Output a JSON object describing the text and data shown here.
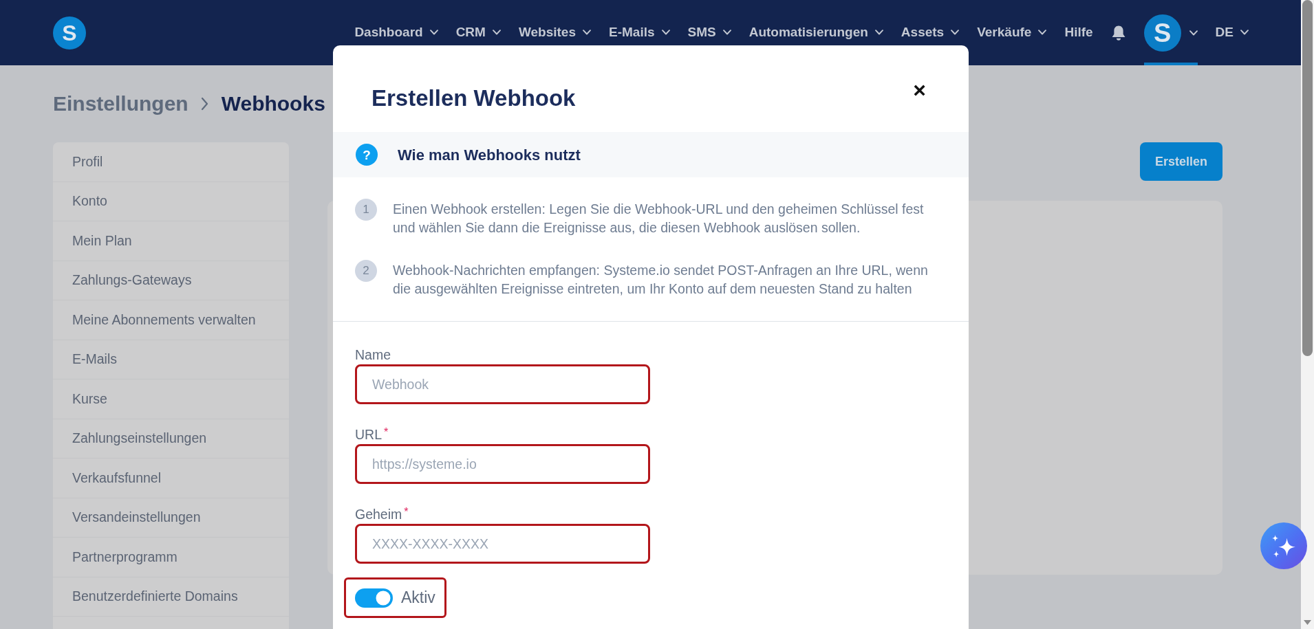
{
  "navbar": {
    "logo": "S",
    "menu": [
      {
        "label": "Dashboard",
        "dropdown": true
      },
      {
        "label": "CRM",
        "dropdown": true
      },
      {
        "label": "Websites",
        "dropdown": true
      },
      {
        "label": "E-Mails",
        "dropdown": true
      },
      {
        "label": "SMS",
        "dropdown": true
      },
      {
        "label": "Automatisierungen",
        "dropdown": true
      },
      {
        "label": "Assets",
        "dropdown": true
      },
      {
        "label": "Verkäufe",
        "dropdown": true
      },
      {
        "label": "Hilfe",
        "dropdown": false
      }
    ],
    "avatar": {
      "initial": "S",
      "active": true
    },
    "language": "DE"
  },
  "breadcrumb": [
    {
      "label": "Einstellungen",
      "current": false
    },
    {
      "label": "Webhooks",
      "current": true
    }
  ],
  "sidebar": {
    "items": [
      {
        "label": "Profil"
      },
      {
        "label": "Konto"
      },
      {
        "label": "Mein Plan"
      },
      {
        "label": "Zahlungs-Gateways"
      },
      {
        "label": "Meine Abonnements verwalten"
      },
      {
        "label": "E-Mails"
      },
      {
        "label": "Kurse"
      },
      {
        "label": "Zahlungseinstellungen"
      },
      {
        "label": "Verkaufsfunnel"
      },
      {
        "label": "Versandeinstellungen"
      },
      {
        "label": "Partnerprogramm"
      },
      {
        "label": "Benutzerdefinierte Domains"
      }
    ]
  },
  "main": {
    "create_button": "Erstellen"
  },
  "modal": {
    "title": "Erstellen Webhook",
    "close": "×",
    "help": {
      "icon": "?",
      "title": "Wie man Webhooks nutzt",
      "steps": [
        {
          "number": "1",
          "text": "Einen Webhook erstellen: Legen Sie die Webhook-URL und den geheimen Schlüssel fest und wählen Sie dann die Ereignisse aus, die diesen Webhook auslösen sollen."
        },
        {
          "number": "2",
          "text": "Webhook-Nachrichten empfangen: Systeme.io sendet POST-Anfragen an Ihre URL, wenn die ausgewählten Ereignisse eintreten, um Ihr Konto auf dem neuesten Stand zu halten"
        }
      ]
    },
    "fields": [
      {
        "label": "Name",
        "placeholder": "Webhook",
        "highlighted": true
      },
      {
        "label": "URL",
        "required_mark": "*",
        "placeholder": "https://systeme.io",
        "highlighted": true
      },
      {
        "label": "Geheim",
        "required_mark": "*",
        "placeholder": "XXXX-XXXX-XXXX",
        "highlighted": true
      }
    ],
    "toggle": {
      "label": "Aktiv",
      "on": true,
      "highlighted": true
    }
  }
}
